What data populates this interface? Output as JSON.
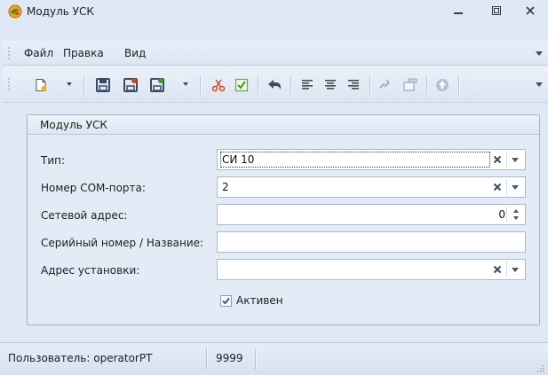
{
  "window": {
    "title": "Модуль УСК",
    "icon": "app-logo-icon",
    "controls": [
      "minimize-icon",
      "maximize-icon",
      "close-icon"
    ]
  },
  "menu": {
    "file": "Файл",
    "edit": "Правка",
    "view": "Вид"
  },
  "toolbar": {
    "icons": [
      "new-document-icon",
      "save-icon",
      "save-close-icon",
      "save-new-icon",
      "cut-icon",
      "check-icon",
      "undo-icon",
      "align-left-icon",
      "align-center-icon",
      "align-right-icon",
      "link-icon",
      "window-icon",
      "up-icon"
    ]
  },
  "group": {
    "title": "Модуль УСК"
  },
  "form": {
    "type": {
      "label": "Тип:",
      "value": "СИ 10"
    },
    "com_port": {
      "label": "Номер COM-порта:",
      "value": "2"
    },
    "net_address": {
      "label": "Сетевой адрес:",
      "value": "0"
    },
    "serial": {
      "label": "Серийный номер / Название:",
      "value": ""
    },
    "install_address": {
      "label": "Адрес установки:",
      "value": ""
    },
    "active": {
      "label": "Активен",
      "checked": true
    }
  },
  "status": {
    "user": "Пользователь: operatorPT",
    "code": "9999"
  },
  "colors": {
    "chrome": "#dfe8f5",
    "group_border": "#9fb3d2",
    "field_border": "#a9b8cf"
  }
}
